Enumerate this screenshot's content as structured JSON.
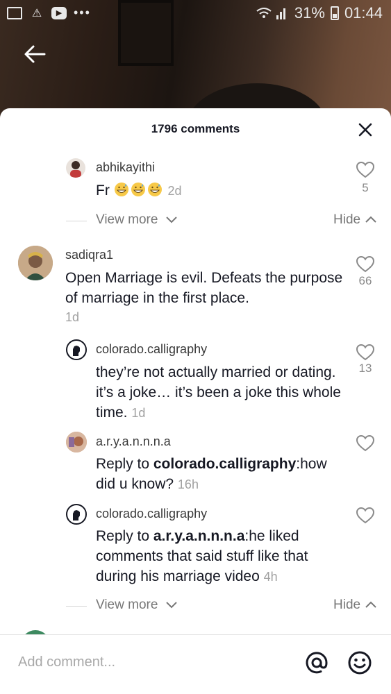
{
  "status_bar": {
    "icons": [
      "gallery-icon",
      "warning-icon",
      "youtube-icon",
      "more-dots-icon"
    ],
    "battery": "31%",
    "time": "01:44"
  },
  "sheet": {
    "title": "1796 comments",
    "close_icon": "close-icon"
  },
  "comments": [
    {
      "username": "abhikayithi",
      "text": "Fr",
      "emoji": [
        "grinning-sweat-emoji",
        "grinning-sweat-emoji",
        "grinning-sweat-emoji"
      ],
      "time": "2d",
      "likes": "5"
    },
    {
      "username": "sadiqra1",
      "text": "Open Marriage is evil. Defeats the purpose of marriage in the first place.",
      "time": "1d",
      "likes": "66"
    },
    {
      "username": "colorado.calligraphy",
      "text": "they’re not actually married or dating. it’s a joke… it’s been a joke this whole time.",
      "time": "1d",
      "likes": "13"
    },
    {
      "username": "a.r.y.a.n.n.n.a",
      "reply_prefix": "Reply to ",
      "reply_to": "colorado.calligraphy",
      "text": ":how did u know?",
      "time": "16h",
      "likes": ""
    },
    {
      "username": "colorado.calligraphy",
      "reply_prefix": "Reply to ",
      "reply_to": "a.r.y.a.n.n.n.a",
      "text": ":he liked comments that said stuff like that during his marriage video",
      "time": "4h",
      "likes": ""
    }
  ],
  "thread_controls": {
    "view_more": "View more",
    "hide": "Hide"
  },
  "composer": {
    "placeholder": "Add comment..."
  },
  "colors": {
    "sheet_bg": "#ffffff",
    "text": "#161823",
    "muted": "#a0a0a0"
  }
}
